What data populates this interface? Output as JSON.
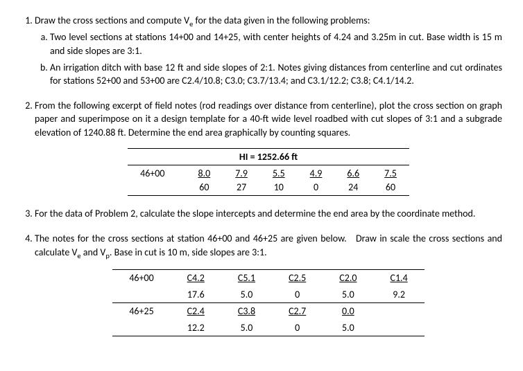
{
  "q1": {
    "intro": "Draw the cross sections and compute Ve for the data given in the following problems:",
    "a": "Two level sections at stations 14+00 and 14+25, with center heights of 4.24 and 3.25m in cut.  Base width is 15 m and side slopes are 3:1.",
    "b": "An irrigation ditch with base 12 ft and side slopes of 2:1.  Notes giving distances from centerline  and cut ordinates for stations 52+00 and 53+00 are C2.4/10.8; C3.0; C3.7/13.4; and C3.1/12.2; C3.8; C4.1/14.2."
  },
  "q2": {
    "text": "From the following excerpt of field notes (rod readings over distance from centerline), plot the cross section on graph paper and superimpose on it a design template for a 40-ft wide level roadbed with cut slopes of 3:1 and a subgrade elevation of 1240.88 ft. Determine the end area graphically by counting squares.",
    "hi": "HI = 1252.66 ft",
    "station": "46+00",
    "r": [
      "8.0",
      "7.9",
      "5.5",
      "4.9",
      "6.6",
      "7.5"
    ],
    "d": [
      "60",
      "27",
      "10",
      "0",
      "24",
      "60"
    ]
  },
  "q3": "For the data of Problem 2, calculate the slope intercepts and determine the end area by the coordinate method.",
  "q4": {
    "text": "The notes for the cross sections at station 46+00 and 46+25 are given below.   Draw in scale the cross sections and calculate Ve and Vp. Base in cut is 10 m, side slopes are 3:1.",
    "rows": [
      {
        "station": "46+00",
        "top": [
          "C4.2",
          "C5.1",
          "C2.5",
          "C2.0",
          "C1.4"
        ],
        "bot": [
          "17.6",
          "5.0",
          "0",
          "5.0",
          "9.2"
        ]
      },
      {
        "station": "46+25",
        "top": [
          "C2.4",
          "C3.8",
          "C2.7",
          "0.0",
          ""
        ],
        "bot": [
          "12.2",
          "5.0",
          "0",
          "5.0",
          ""
        ]
      }
    ]
  }
}
